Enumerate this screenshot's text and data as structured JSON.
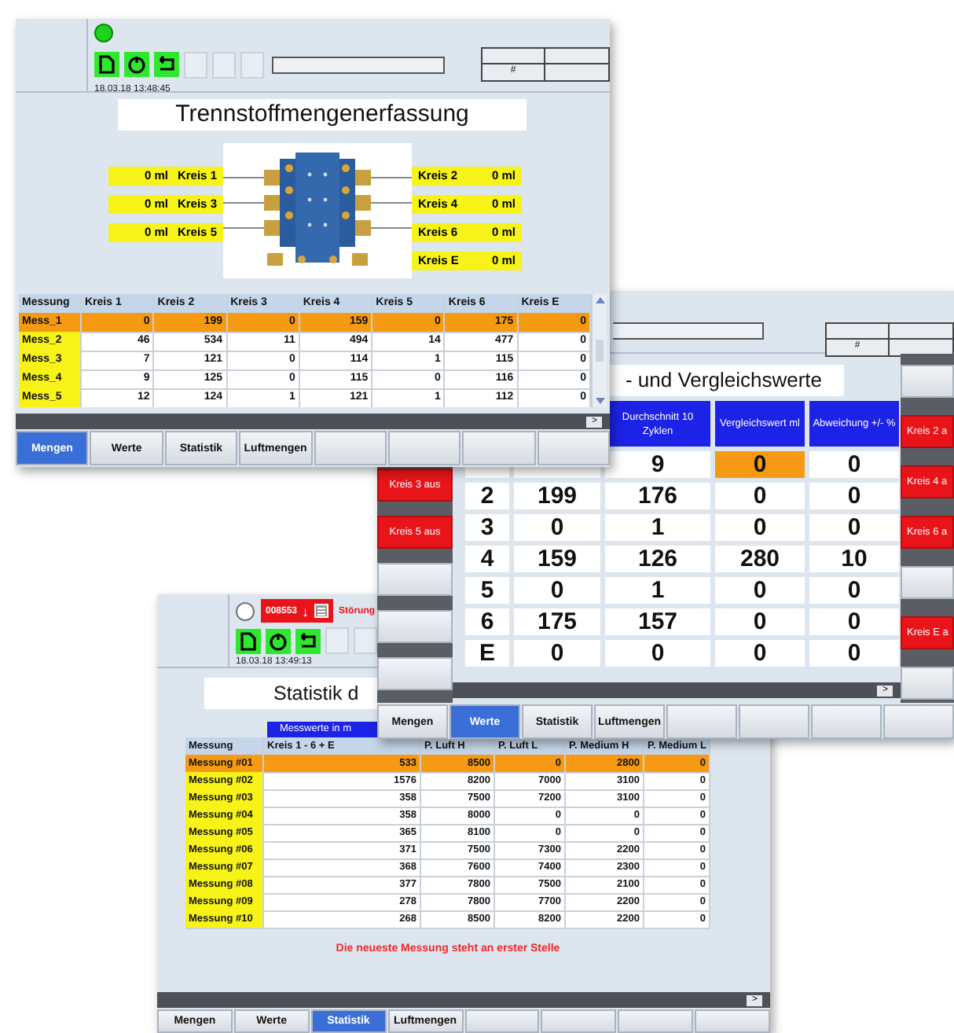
{
  "mengen_window": {
    "lamp_on": true,
    "datetime": "18.03.18 13:48:45",
    "counter": "#",
    "title": "Trennstoffmengenerfassung",
    "circuits_left": [
      {
        "value": "0 ml",
        "label": "Kreis 1"
      },
      {
        "value": "0 ml",
        "label": "Kreis 3"
      },
      {
        "value": "0 ml",
        "label": "Kreis 5"
      }
    ],
    "circuits_right": [
      {
        "label": "Kreis 2",
        "value": "0 ml"
      },
      {
        "label": "Kreis 4",
        "value": "0 ml"
      },
      {
        "label": "Kreis 6",
        "value": "0 ml"
      },
      {
        "label": "Kreis E",
        "value": "0 ml"
      }
    ],
    "table": {
      "columns": [
        "Messung",
        "Kreis 1",
        "Kreis 2",
        "Kreis 3",
        "Kreis 4",
        "Kreis 5",
        "Kreis 6",
        "Kreis E"
      ],
      "rows": [
        {
          "selected": true,
          "cells": [
            "Mess_1",
            "0",
            "199",
            "0",
            "159",
            "0",
            "175",
            "0"
          ]
        },
        {
          "selected": false,
          "cells": [
            "Mess_2",
            "46",
            "534",
            "11",
            "494",
            "14",
            "477",
            "0"
          ]
        },
        {
          "selected": false,
          "cells": [
            "Mess_3",
            "7",
            "121",
            "0",
            "114",
            "1",
            "115",
            "0"
          ]
        },
        {
          "selected": false,
          "cells": [
            "Mess_4",
            "9",
            "125",
            "0",
            "115",
            "0",
            "116",
            "0"
          ]
        },
        {
          "selected": false,
          "cells": [
            "Mess_5",
            "12",
            "124",
            "1",
            "121",
            "1",
            "112",
            "0"
          ]
        }
      ]
    },
    "page_arrow": ">",
    "tabs": [
      {
        "label": "Mengen",
        "selected": true
      },
      {
        "label": "Werte",
        "selected": false
      },
      {
        "label": "Statistik",
        "selected": false
      },
      {
        "label": "Luftmengen",
        "selected": false
      }
    ]
  },
  "werte_window": {
    "counter": "#",
    "title": "- und Vergleichswerte",
    "left_buttons": [
      {
        "label": "Kreis 3 aus",
        "alarm": true
      },
      {
        "label": "Kreis 5 aus",
        "alarm": true
      },
      {
        "alarm": false
      },
      {
        "alarm": false
      },
      {
        "alarm": false
      }
    ],
    "right_buttons": [
      {
        "alarm": false
      },
      {
        "label": "Kreis 2 a",
        "alarm": true
      },
      {
        "label": "Kreis 4 a",
        "alarm": true
      },
      {
        "label": "Kreis 6 a",
        "alarm": true
      },
      {
        "alarm": false
      },
      {
        "label": "Kreis E a",
        "alarm": true
      },
      {
        "alarm": false
      }
    ],
    "table": {
      "columns": [
        "Durchschnitt 10 Zyklen",
        "Vergleichswert ml",
        "Abweichung +/- %"
      ],
      "rows": [
        {
          "comparison_highlighted": true,
          "cells": [
            "9",
            "0",
            "0"
          ]
        },
        {
          "comparison_highlighted": false,
          "cells": [
            "2",
            "199",
            "176",
            "0",
            "0"
          ]
        },
        {
          "comparison_highlighted": false,
          "cells": [
            "3",
            "0",
            "1",
            "0",
            "0"
          ]
        },
        {
          "comparison_highlighted": false,
          "cells": [
            "4",
            "159",
            "126",
            "280",
            "10"
          ]
        },
        {
          "comparison_highlighted": false,
          "cells": [
            "5",
            "0",
            "1",
            "0",
            "0"
          ]
        },
        {
          "comparison_highlighted": false,
          "cells": [
            "6",
            "175",
            "157",
            "0",
            "0"
          ]
        },
        {
          "comparison_highlighted": false,
          "cells": [
            "E",
            "0",
            "0",
            "0",
            "0"
          ]
        }
      ]
    },
    "page_arrow": ">",
    "tabs": [
      {
        "label": "Mengen",
        "selected": false
      },
      {
        "label": "Werte",
        "selected": true
      },
      {
        "label": "Statistik",
        "selected": false
      },
      {
        "label": "Luftmengen",
        "selected": false
      }
    ]
  },
  "statistik_window": {
    "lamp_on": false,
    "alarm": {
      "code": "008553",
      "arrow": "↓",
      "text": "Störung"
    },
    "datetime": "18.03.18 13:49:13",
    "title": "Statistik d",
    "band": "Messwerte in m",
    "table": {
      "columns": [
        "Messung",
        "Kreis 1 - 6 + E",
        "P. Luft H",
        "P. Luft L",
        "P. Medium H",
        "P. Medium L"
      ],
      "rows": [
        {
          "selected": true,
          "cells": [
            "Messung #01",
            "533",
            "8500",
            "0",
            "2800",
            "0"
          ]
        },
        {
          "selected": false,
          "cells": [
            "Messung #02",
            "1576",
            "8200",
            "7000",
            "3100",
            "0"
          ]
        },
        {
          "selected": false,
          "cells": [
            "Messung #03",
            "358",
            "7500",
            "7200",
            "3100",
            "0"
          ]
        },
        {
          "selected": false,
          "cells": [
            "Messung #04",
            "358",
            "8000",
            "0",
            "0",
            "0"
          ]
        },
        {
          "selected": false,
          "cells": [
            "Messung #05",
            "365",
            "8100",
            "0",
            "0",
            "0"
          ]
        },
        {
          "selected": false,
          "cells": [
            "Messung #06",
            "371",
            "7500",
            "7300",
            "2200",
            "0"
          ]
        },
        {
          "selected": false,
          "cells": [
            "Messung #07",
            "368",
            "7600",
            "7400",
            "2300",
            "0"
          ]
        },
        {
          "selected": false,
          "cells": [
            "Messung #08",
            "377",
            "7800",
            "7500",
            "2100",
            "0"
          ]
        },
        {
          "selected": false,
          "cells": [
            "Messung #09",
            "278",
            "7800",
            "7700",
            "2200",
            "0"
          ]
        },
        {
          "selected": false,
          "cells": [
            "Messung #10",
            "268",
            "8500",
            "8200",
            "2200",
            "0"
          ]
        }
      ]
    },
    "message": "Die neueste Messung steht an erster Stelle",
    "page_arrow": ">",
    "tabs": [
      {
        "label": "Mengen",
        "selected": false
      },
      {
        "label": "Werte",
        "selected": false
      },
      {
        "label": "Statistik",
        "selected": true
      },
      {
        "label": "Luftmengen",
        "selected": false
      }
    ]
  }
}
